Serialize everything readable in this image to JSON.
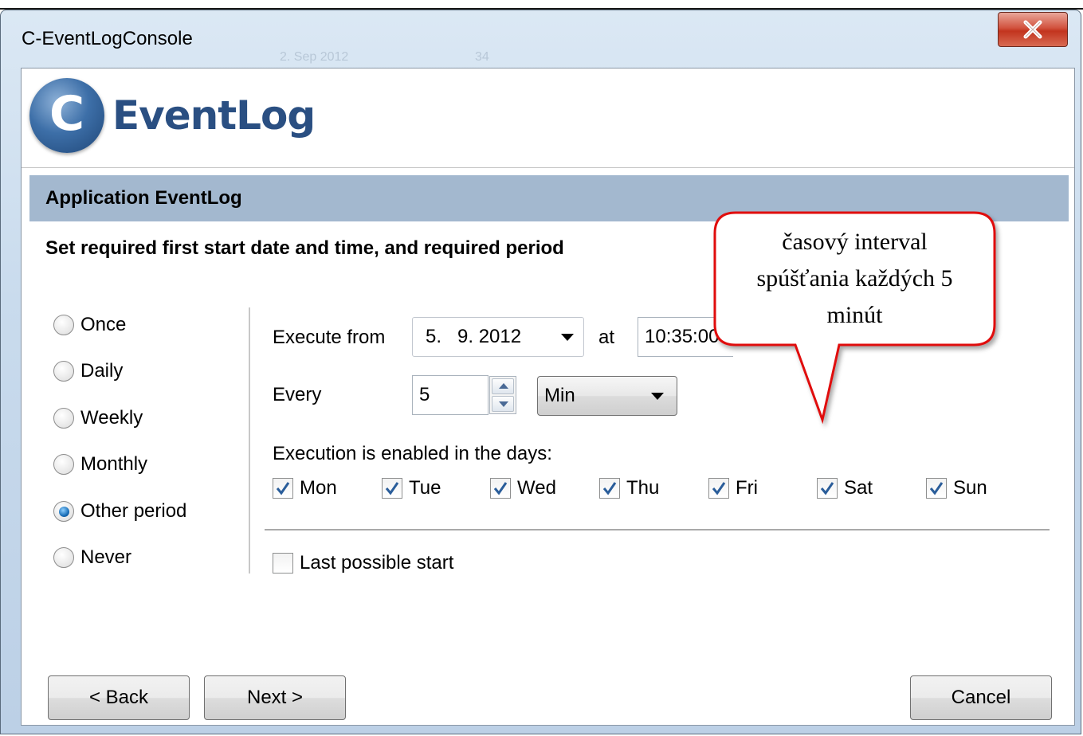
{
  "window": {
    "title": "C-EventLogConsole",
    "close_label": "X",
    "background_ghost": [
      "2. Sep 2012",
      "34"
    ]
  },
  "logo": {
    "letter": "C",
    "text": "EventLog"
  },
  "section": {
    "title": "Application EventLog"
  },
  "instruction": "Set required first start date and time, and required period",
  "schedule_options": [
    {
      "label": "Once",
      "selected": false
    },
    {
      "label": "Daily",
      "selected": false
    },
    {
      "label": "Weekly",
      "selected": false
    },
    {
      "label": "Monthly",
      "selected": false
    },
    {
      "label": "Other period",
      "selected": true
    },
    {
      "label": "Never",
      "selected": false
    }
  ],
  "execute_from": {
    "label": "Execute from",
    "date": "5.   9. 2012",
    "at_label": "at",
    "time": "10:35:00"
  },
  "every": {
    "label": "Every",
    "value": "5",
    "unit": "Min"
  },
  "days": {
    "label": "Execution is enabled in the days:",
    "items": [
      {
        "label": "Mon",
        "checked": true
      },
      {
        "label": "Tue",
        "checked": true
      },
      {
        "label": "Wed",
        "checked": true
      },
      {
        "label": "Thu",
        "checked": true
      },
      {
        "label": "Fri",
        "checked": true
      },
      {
        "label": "Sat",
        "checked": true
      },
      {
        "label": "Sun",
        "checked": true
      }
    ]
  },
  "last_possible_start": {
    "label": "Last possible start",
    "checked": false
  },
  "buttons": {
    "back": "< Back",
    "next": "Next >",
    "cancel": "Cancel"
  },
  "callout": {
    "lines": [
      "časový interval",
      "spúšťania každých 5",
      "minút"
    ],
    "border_color": "#e01010"
  }
}
